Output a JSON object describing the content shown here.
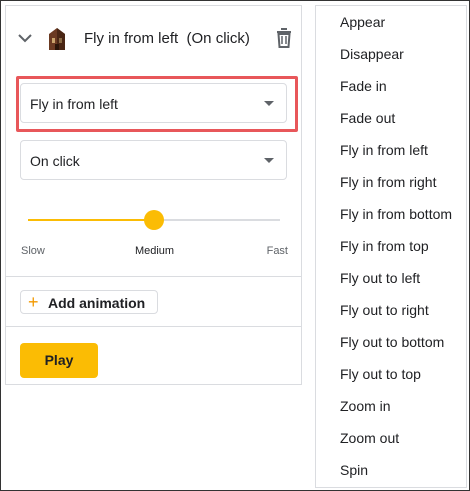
{
  "panel": {
    "title": "Fly in from left  (On click)",
    "animation_select": "Fly in from left",
    "trigger_select": "On click",
    "speed": {
      "slow_label": "Slow",
      "medium_label": "Medium",
      "fast_label": "Fast",
      "value_fraction": 0.5
    },
    "add_animation_label": "Add animation",
    "play_label": "Play"
  },
  "menu": {
    "items": [
      "Appear",
      "Disappear",
      "Fade in",
      "Fade out",
      "Fly in from left",
      "Fly in from right",
      "Fly in from bottom",
      "Fly in from top",
      "Fly out to left",
      "Fly out to right",
      "Fly out to bottom",
      "Fly out to top",
      "Zoom in",
      "Zoom out",
      "Spin"
    ]
  },
  "colors": {
    "accent": "#fbbc04",
    "highlight_border": "#e8575a",
    "add_plus": "#f29900"
  },
  "icons": [
    "chevron-down-icon",
    "slide-thumbnail-icon",
    "trash-icon",
    "dropdown-caret-icon",
    "plus-icon"
  ]
}
